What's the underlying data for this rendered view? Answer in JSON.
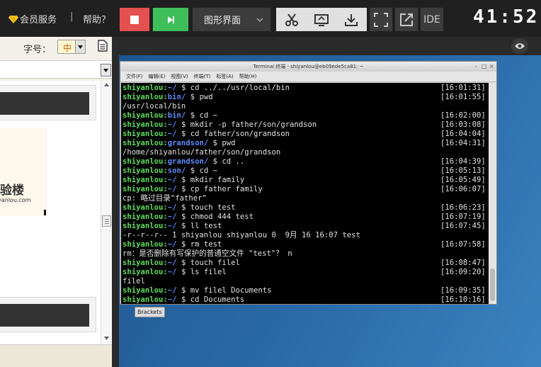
{
  "topbar": {
    "member_label": "会员服务",
    "separator": "|",
    "help_label": "帮助？",
    "mode_label": "图形界面",
    "ide_label": "IDE",
    "timer": "41:52",
    "icons": [
      "diamond-icon",
      "stop-icon",
      "run-icon",
      "chevron-down-icon",
      "scissors-icon",
      "clipboard-icon",
      "download-icon",
      "fullscreen-icon",
      "external-link-icon",
      "eye-icon"
    ]
  },
  "left_panel": {
    "font_size_label": "字号：",
    "font_size_value": "中",
    "logo_text": "实验楼",
    "logo_url": "yanlou.com"
  },
  "terminal": {
    "title": "Terminal 终端 - shiyanlou@eb09ede5ca81: ~",
    "menu": [
      "文件(F)",
      "编辑(E)",
      "视图(V)",
      "终端(T)",
      "标签(A)",
      "帮助(H)"
    ],
    "lines": [
      {
        "user": "shiyanlou",
        "path": "~",
        "cmd": "cd ../../usr/local/bin",
        "time": "[16:01:31]"
      },
      {
        "user": "shiyanlou",
        "path": "bin",
        "cmd": "pwd",
        "time": "[16:01:55]"
      },
      {
        "output": "/usr/local/bin"
      },
      {
        "user": "shiyanlou",
        "path": "bin",
        "cmd": "cd ~",
        "time": "[16:02:00]"
      },
      {
        "user": "shiyanlou",
        "path": "~",
        "cmd": "mkdir -p father/son/grandson",
        "time": "[16:03:08]"
      },
      {
        "user": "shiyanlou",
        "path": "~",
        "cmd": "cd father/son/grandson",
        "time": "[16:04:04]"
      },
      {
        "user": "shiyanlou",
        "path": "grandson",
        "cmd": "pwd",
        "time": "[16:04:31]"
      },
      {
        "output": "/home/shiyanlou/father/son/grandson"
      },
      {
        "user": "shiyanlou",
        "path": "grandson",
        "cmd": "cd ..",
        "time": "[16:04:39]"
      },
      {
        "user": "shiyanlou",
        "path": "son",
        "cmd": "cd ~",
        "time": "[16:05:13]"
      },
      {
        "user": "shiyanlou",
        "path": "~",
        "cmd": "mkdir family",
        "time": "[16:05:49]"
      },
      {
        "user": "shiyanlou",
        "path": "~",
        "cmd": "cp father family",
        "time": "[16:06:07]"
      },
      {
        "output": "cp: 略过目录\"father\""
      },
      {
        "user": "shiyanlou",
        "path": "~",
        "cmd": "touch test",
        "time": "[16:06:23]"
      },
      {
        "user": "shiyanlou",
        "path": "~",
        "cmd": "chmod 444 test",
        "time": "[16:07:19]"
      },
      {
        "user": "shiyanlou",
        "path": "~",
        "cmd": "ll test",
        "time": "[16:07:45]"
      },
      {
        "output": "-r--r--r-- 1 shiyanlou shiyanlou 0  9月 16 16:07 test"
      },
      {
        "user": "shiyanlou",
        "path": "~",
        "cmd": "rm test",
        "time": "[16:07:58]"
      },
      {
        "output": "rm：是否删除有写保护的普通空文件 \"test\"？ n"
      },
      {
        "user": "shiyanlou",
        "path": "~",
        "cmd": "touch filel",
        "time": "[16:08:47]"
      },
      {
        "user": "shiyanlou",
        "path": "~",
        "cmd": "ls filel",
        "time": "[16:09:20]"
      },
      {
        "output": "filel"
      },
      {
        "user": "shiyanlou",
        "path": "~",
        "cmd": "mv filel Documents",
        "time": "[16:09:35]"
      },
      {
        "user": "shiyanlou",
        "path": "~",
        "cmd": "cd Documents",
        "time": "[16:10:16]"
      }
    ]
  },
  "desktop": {
    "brackets_label": "Brackets"
  },
  "colors": {
    "stop": "#e55050",
    "run": "#3fbf5a",
    "prompt_user": "#5be05b",
    "prompt_path": "#5b8cff"
  }
}
